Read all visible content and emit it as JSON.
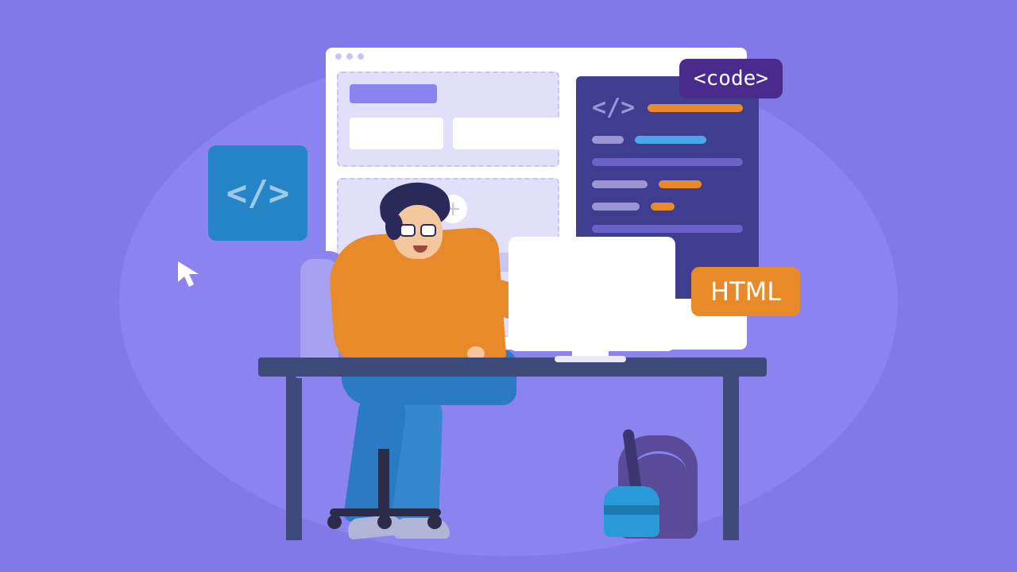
{
  "badges": {
    "code": "<code>",
    "html": "HTML"
  },
  "glyphs": {
    "tile": "</>",
    "editor": "</>",
    "plus": "+"
  },
  "colors": {
    "bg": "#8179e8",
    "bg_light": "#8b84f0",
    "orange": "#e88a2a",
    "blue_tile": "#2484c6",
    "editor_bg": "#3f3d8f",
    "code_badge_bg": "#4a2a8c",
    "desk": "#3d4a7a",
    "pants": "#2a7bc4",
    "line_purple": "#6a62c8",
    "line_grey": "#9a96d4",
    "line_orange": "#e88a2a",
    "line_blue": "#4aa8e8"
  }
}
